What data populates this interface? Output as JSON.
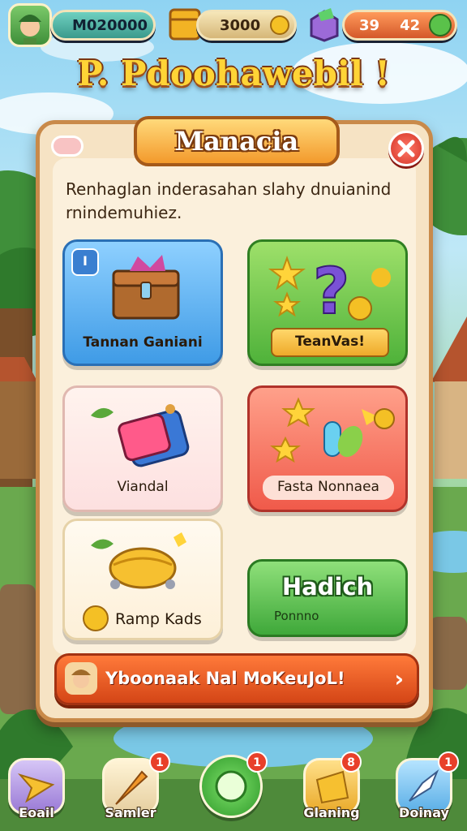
{
  "hud": {
    "coins_text": "M020000",
    "gold_text": "3000",
    "gems_text": "39    42"
  },
  "banner_title": "P. Pdoohawebil !",
  "panel": {
    "header": "Manacia",
    "description": "Renhaglan inderasahan slahy dnuianind rnindemuhiez.",
    "cards": [
      {
        "label": "Tannan Ganiani",
        "badge": "I"
      },
      {
        "label": "TeanVas!"
      },
      {
        "label": "Viandal"
      },
      {
        "label": "Fasta Nonnaea"
      },
      {
        "label": "Ramp Kads"
      },
      {
        "label": "Hadich",
        "sub": "Ponnno"
      }
    ],
    "bottom_banner": "Yboonaak Nal MoKeuJoL!"
  },
  "nav": [
    {
      "label": "Eoail",
      "badge": ""
    },
    {
      "label": "Samler",
      "badge": "1"
    },
    {
      "label": "",
      "badge": "1"
    },
    {
      "label": "Glaning",
      "badge": "8"
    },
    {
      "label": "Doinay",
      "badge": "1"
    }
  ]
}
